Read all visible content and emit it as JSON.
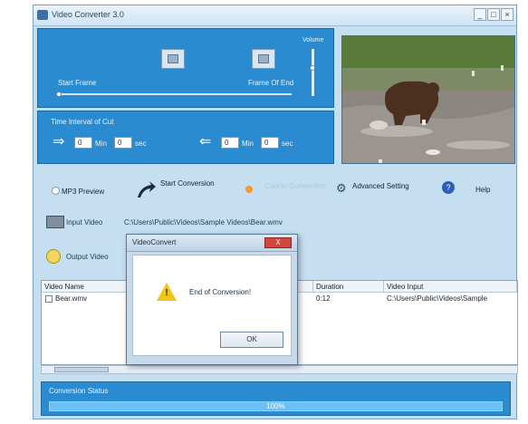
{
  "window": {
    "title": "Video Converter 3.0"
  },
  "player": {
    "start_frame_label": "Start Frame",
    "end_frame_label": "Frame Of End",
    "volume_label": "Volume"
  },
  "interval": {
    "label": "Time Interval of Cut",
    "start_h": "0",
    "start_m": "0",
    "unit_mins": "Min",
    "unit_sec": "sec",
    "end_h": "0",
    "end_m": "0"
  },
  "toolbar": {
    "mp3_preview": "MP3 Preview",
    "start_conversion": "Start Conversion",
    "cancel_conversion": "Cancel Conversion",
    "advanced_setting": "Advanced Setting",
    "help": "Help"
  },
  "paths": {
    "input_label": "Input Video",
    "input_value": "C:\\Users\\Public\\Videos\\Sample Videos\\Bear.wmv",
    "output_label": "Output Video"
  },
  "table": {
    "columns": [
      "Video Name",
      "Duration",
      "Video Input"
    ],
    "rows": [
      {
        "name": "Bear.wmv",
        "duration": "0:12",
        "input": "C:\\Users\\Public\\Videos\\Sample"
      }
    ]
  },
  "status": {
    "label": "Conversion Status",
    "progress_text": "100%",
    "progress_value": 1.0
  },
  "dialog": {
    "title": "VideoConvert",
    "close": "X",
    "message": "End of Conversion!",
    "ok": "OK"
  }
}
